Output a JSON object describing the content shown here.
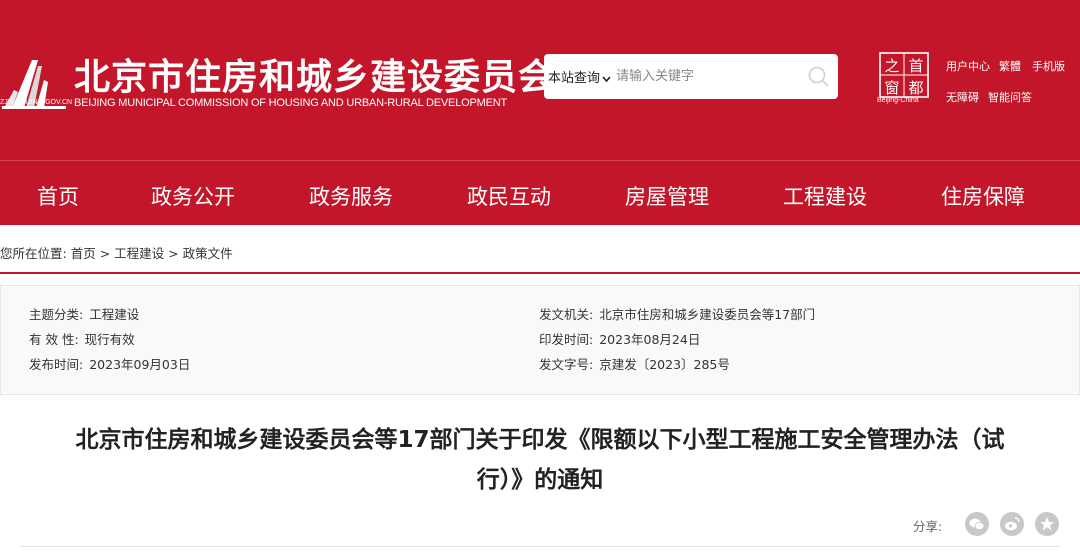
{
  "header": {
    "logo_domain": "ZJW.BEIJING.GOV.CN",
    "site_title": "北京市住房和城乡建设委员会",
    "site_subtitle": "BEIJING MUNICIPAL COMMISSION OF HOUSING AND URBAN-RURAL DEVELOPMENT",
    "search": {
      "scope_label": "本站查询",
      "placeholder": "请输入关键字"
    },
    "seal": {
      "chars": [
        "之",
        "首",
        "窗",
        "都"
      ],
      "caption": "Beijing-China"
    },
    "links": {
      "user_center": "用户中心",
      "traditional": "繁體",
      "mobile": "手机版",
      "accessibility": "无障碍",
      "smart_qa": "智能问答"
    },
    "colors": {
      "brand_red": "#c3162a"
    }
  },
  "nav": {
    "items": [
      "首页",
      "政务公开",
      "政务服务",
      "政民互动",
      "房屋管理",
      "工程建设",
      "住房保障"
    ]
  },
  "breadcrumb": {
    "prefix": "您所在位置:",
    "items": [
      "首页",
      "工程建设",
      "政策文件"
    ],
    "separator": ">"
  },
  "meta": {
    "left": [
      {
        "label": "主题分类:",
        "value": "工程建设"
      },
      {
        "label": "有 效 性:",
        "value": "现行有效"
      },
      {
        "label": "发布时间:",
        "value": "2023年09月03日"
      }
    ],
    "right": [
      {
        "label": "发文机关:",
        "value": "北京市住房和城乡建设委员会等17部门"
      },
      {
        "label": "印发时间:",
        "value": "2023年08月24日"
      },
      {
        "label": "发文字号:",
        "value": "京建发〔2023〕285号"
      }
    ]
  },
  "document": {
    "title_line1": "北京市住房和城乡建设委员会等17部门关于印发《限额以下小型工程施工安全管理办法（试",
    "title_line2": "行）》的通知"
  },
  "share": {
    "label": "分享:",
    "icons": [
      "wechat-icon",
      "weibo-icon",
      "favorite-star-icon"
    ]
  }
}
